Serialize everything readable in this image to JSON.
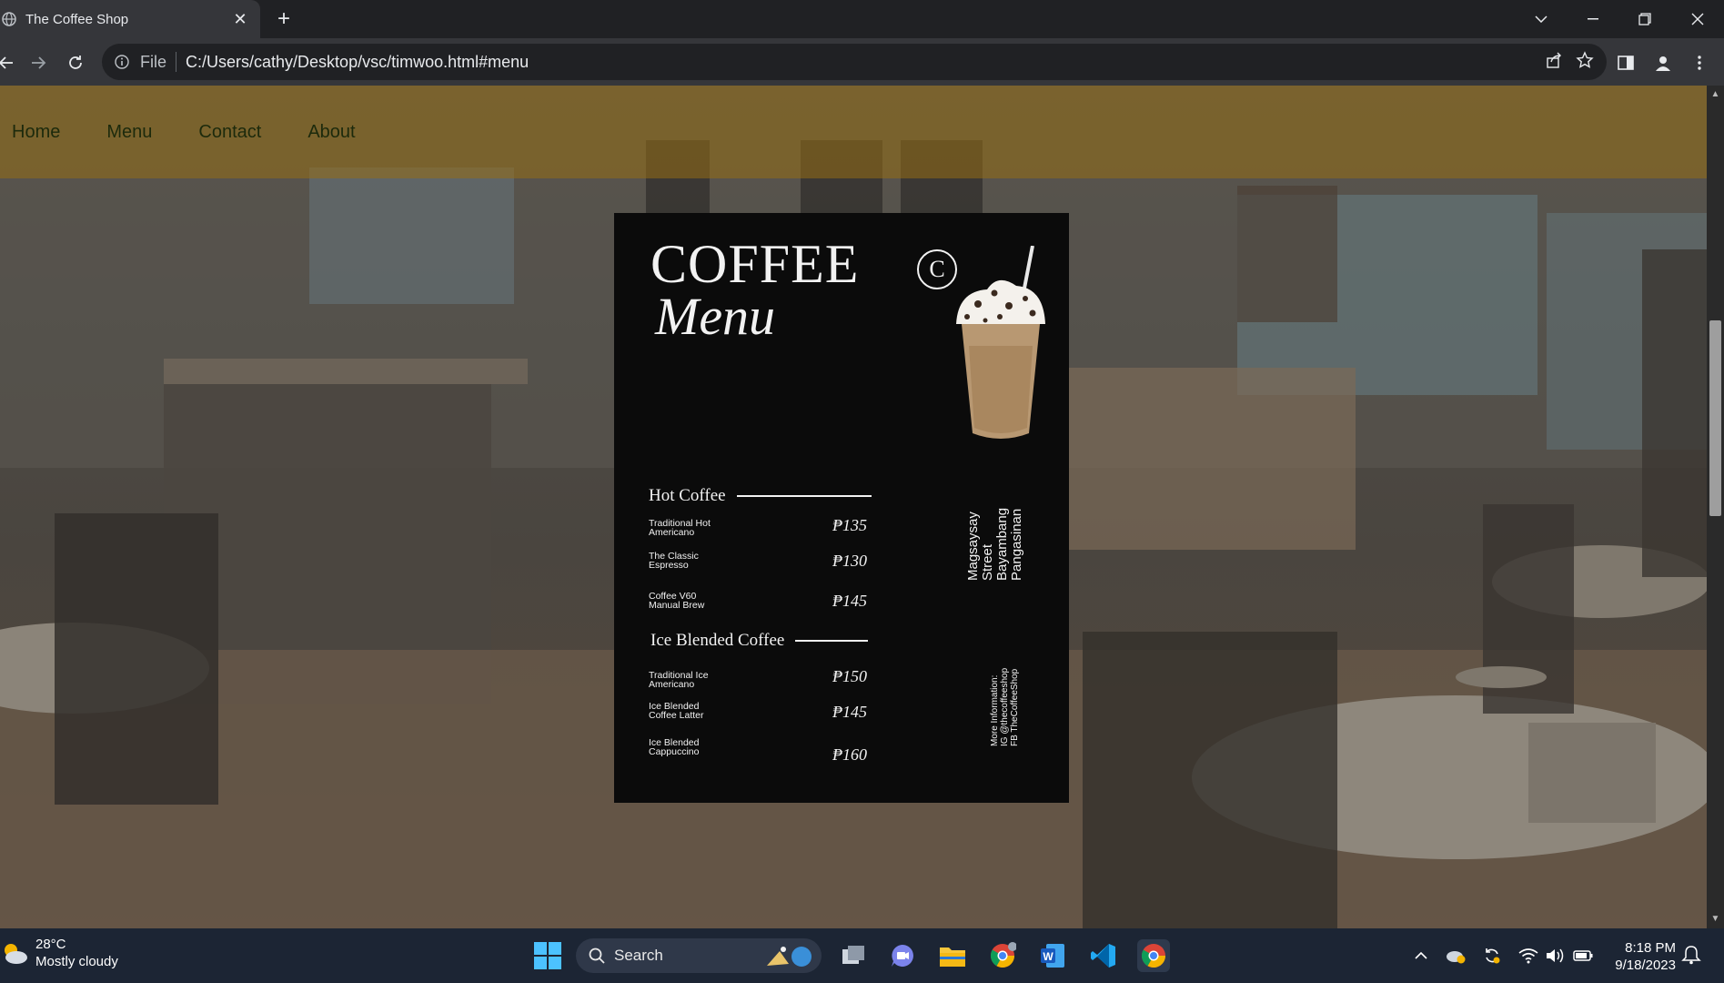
{
  "browser": {
    "tab_title": "The Coffee Shop",
    "address_scheme": "File",
    "address_url": "C:/Users/cathy/Desktop/vsc/timwoo.html#menu"
  },
  "site": {
    "nav": [
      "Home",
      "Menu",
      "Contact",
      "About"
    ]
  },
  "menu_card": {
    "title": "COFFEE",
    "subtitle": "Menu",
    "logo_letter": "C",
    "sections": [
      {
        "heading": "Hot Coffee",
        "items": [
          {
            "name": "Traditional Hot\nAmericano",
            "price": "₱135"
          },
          {
            "name": "The Classic\nEspresso",
            "price": "₱130"
          },
          {
            "name": "Coffee V60\nManual Brew",
            "price": "₱145"
          }
        ]
      },
      {
        "heading": "Ice Blended Coffee",
        "items": [
          {
            "name": "Traditional Ice\nAmericano",
            "price": "₱150"
          },
          {
            "name": "Ice Blended\nCoffee Latter",
            "price": "₱145"
          },
          {
            "name": "Ice Blended\nCappuccino",
            "price": "₱160"
          }
        ]
      }
    ],
    "address": "Magsaysay\nStreet\nBayambang\nPangasinan",
    "more_info": "More Information:\nIG @thecoffeeshop\nFB TheCoffeeShop"
  },
  "taskbar": {
    "temperature": "28°C",
    "weather": "Mostly cloudy",
    "search_label": "Search",
    "time": "8:18 PM",
    "date": "9/18/2023"
  },
  "colors": {
    "nav_text": "#1c2a0c",
    "card_bg": "#0b0b0b",
    "taskbar_bg": "#1c2534"
  }
}
